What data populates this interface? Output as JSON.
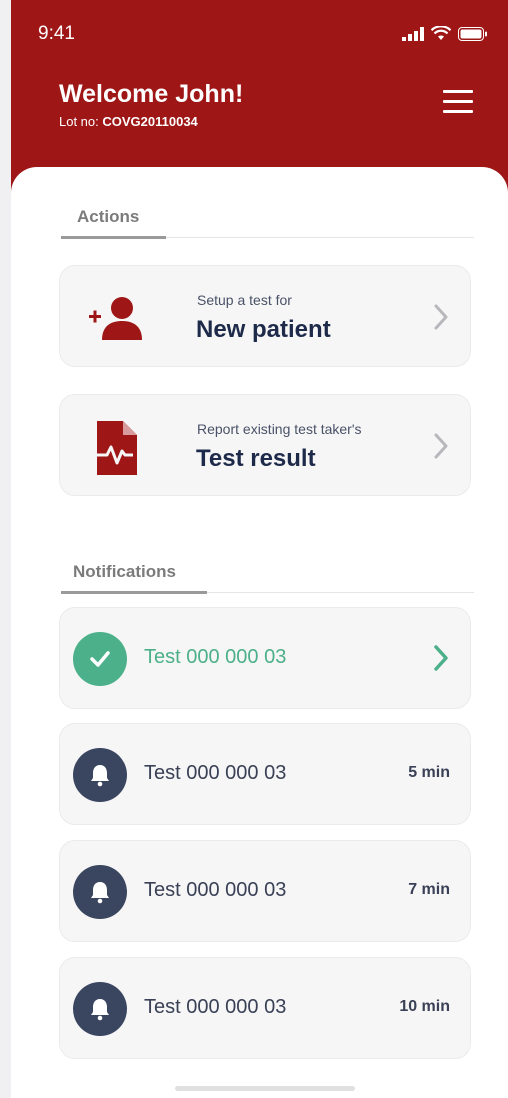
{
  "status_bar": {
    "time": "9:41"
  },
  "header": {
    "welcome": "Welcome John!",
    "lot_label": "Lot no: ",
    "lot_number": "COVG20110034"
  },
  "actions": {
    "label": "Actions",
    "items": [
      {
        "subtitle": "Setup a test for",
        "title": "New patient",
        "icon": "add-user-icon"
      },
      {
        "subtitle": "Report existing test taker's",
        "title": "Test result",
        "icon": "document-pulse-icon"
      }
    ]
  },
  "notifications": {
    "label": "Notifications",
    "items": [
      {
        "title": "Test 000 000 03",
        "status": "done",
        "icon": "checkmark-icon"
      },
      {
        "title": "Test 000 000 03",
        "time": "5 min",
        "icon": "bell-icon"
      },
      {
        "title": "Test 000 000 03",
        "time": "7 min",
        "icon": "bell-icon"
      },
      {
        "title": "Test 000 000 03",
        "time": "10 min",
        "icon": "bell-icon"
      }
    ]
  },
  "colors": {
    "brand": "#9e1616",
    "success": "#4cb08a",
    "bell_bg": "#3a4560",
    "text_dark": "#1e2a4a"
  }
}
